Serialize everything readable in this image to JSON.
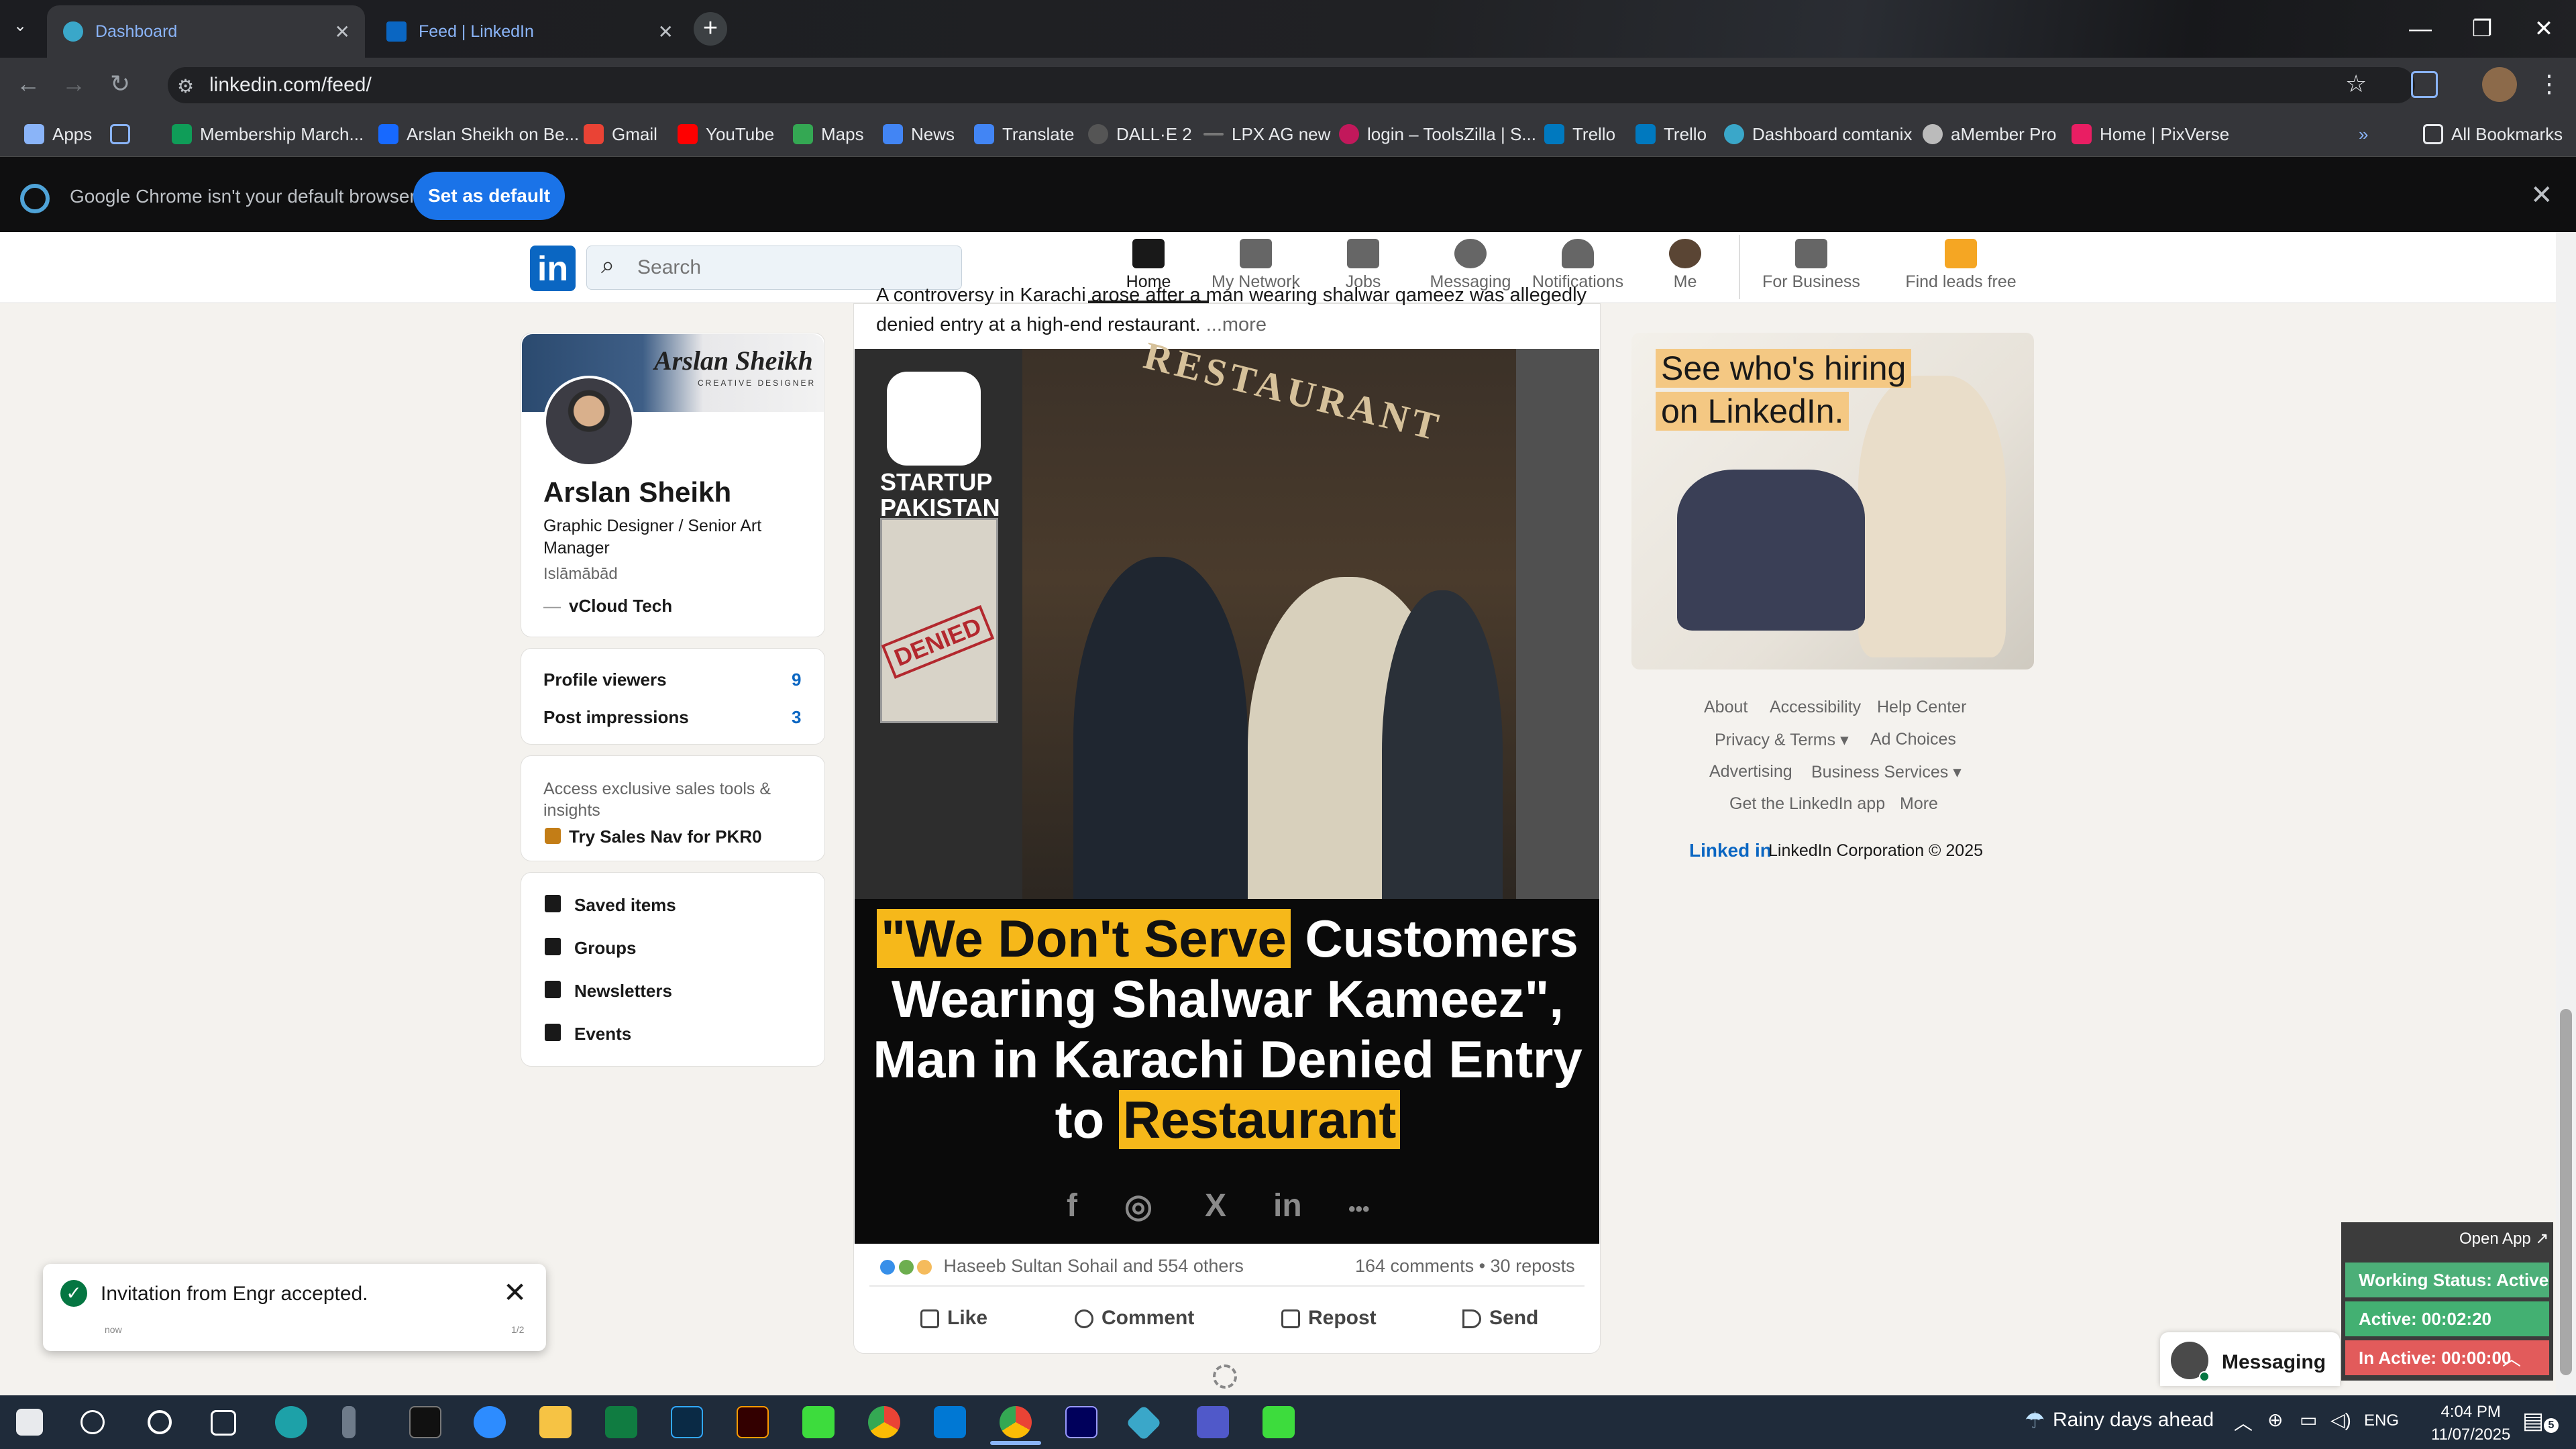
{
  "browser": {
    "tabs": [
      {
        "label": "Dashboard",
        "icon": "dashboard-favicon-icon"
      },
      {
        "label": "Feed | LinkedIn",
        "icon": "linkedin-favicon-icon"
      }
    ],
    "url": "linkedin.com/feed/",
    "bookmarks": [
      "Apps",
      "Membership March...",
      "Arslan Sheikh on Be...",
      "Gmail",
      "YouTube",
      "Maps",
      "News",
      "Translate",
      "DALL·E 2",
      "LPX AG new",
      "login – ToolsZilla | S...",
      "Trello",
      "Trello",
      "Dashboard comtanix",
      "aMember Pro",
      "Home | PixVerse",
      "All Bookmarks"
    ],
    "default_banner": {
      "text": "Google Chrome isn't your default browser",
      "button": "Set as default"
    }
  },
  "linkedin": {
    "logo": "in",
    "search_placeholder": "Search",
    "nav": [
      "Home",
      "My Network",
      "Jobs",
      "Messaging",
      "Notifications",
      "Me",
      "For Business",
      "Find leads free"
    ],
    "profile": {
      "banner_name": "Arslan Sheikh",
      "banner_sub": "CREATIVE DESIGNER",
      "name": "Arslan Sheikh",
      "headline": "Graphic Designer / Senior Art Manager",
      "location": "Islāmābād",
      "company": "vCloud Tech"
    },
    "stats": [
      {
        "label": "Profile viewers",
        "value": "9"
      },
      {
        "label": "Post impressions",
        "value": "3"
      }
    ],
    "premium": {
      "text": "Access exclusive sales tools & insights",
      "link": "Try Sales Nav for PKR0"
    },
    "menu": [
      "Saved items",
      "Groups",
      "Newsletters",
      "Events"
    ],
    "post": {
      "text_partial": "A controversy in Karachi arose after a man wearing shalwar qameez was allegedly",
      "text_line2": "denied entry at a high-end restaurant.",
      "more": "...more",
      "image": {
        "sign": "RESTAURANT",
        "logo_text_1": "STARTUP",
        "logo_text_2": "PAKISTAN",
        "poster_stamp": "DENIED",
        "headline_part1": "\"We Don't Serve",
        "headline_part2": " Customers",
        "headline_line2": "Wearing Shalwar Kameez\",",
        "headline_line3": "Man in Karachi Denied Entry",
        "headline_line4_a": "to ",
        "headline_line4_b": "Restaurant",
        "social": [
          "f",
          "◎",
          "X",
          "in",
          "•••"
        ]
      },
      "reactions": "Haseeb Sultan Sohail and 554 others",
      "stats": "164 comments • 30 reposts",
      "actions": [
        "Like",
        "Comment",
        "Repost",
        "Send"
      ]
    },
    "ad": {
      "line1": "See who's hiring",
      "line2": "on LinkedIn."
    },
    "footer": {
      "links": [
        "About",
        "Accessibility",
        "Help Center",
        "Privacy & Terms ▾",
        "Ad Choices",
        "Advertising",
        "Business Services ▾",
        "Get the LinkedIn app",
        "More"
      ],
      "brand": "Linked in",
      "corp": "LinkedIn Corporation © 2025"
    },
    "messaging": "Messaging"
  },
  "toast": {
    "text": "Invitation from Engr accepted.",
    "time": "now",
    "count": "1/2"
  },
  "status_widget": {
    "open_app": "Open App ↗",
    "working": "Working Status: Active",
    "active": "Active: 00:02:20",
    "inactive": "In Active: 00:00:00",
    "colors": {
      "working": "#4caf78",
      "active": "#43b072",
      "inactive": "#e25b5b"
    }
  },
  "taskbar": {
    "weather": "Rainy days ahead",
    "lang": "ENG",
    "time": "4:04 PM",
    "date": "11/07/2025"
  }
}
